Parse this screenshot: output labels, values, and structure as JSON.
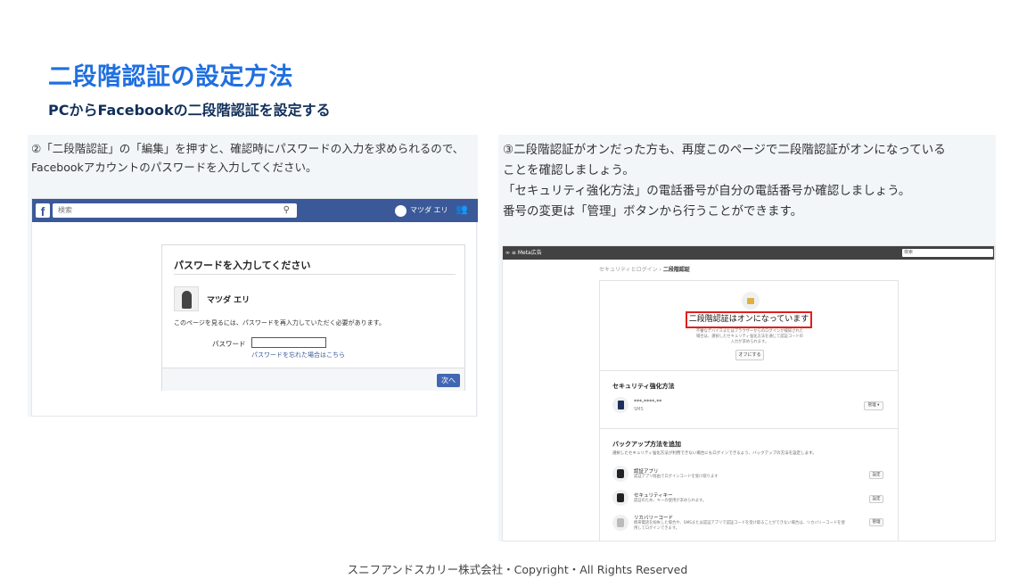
{
  "slide": {
    "title": "二段階認証の設定方法",
    "subtitle": "PCからFacebookの二段階認証を設定する",
    "footer": "スニフアンドスカリー株式会社・Copyright・All Rights Reserved"
  },
  "left_panel": {
    "caption": "②「二段階認証」の「編集」を押すと、確認時にパスワードの入力を求められるので、 Facebookアカウントのパスワードを入力してください。",
    "facebook": {
      "logo": "f",
      "search_placeholder": "検索",
      "user_name": "マツダ エリ",
      "dialog_title": "パスワードを入力してください",
      "dialog_user": "マツダ エリ",
      "dialog_text": "このページを見るには、パスワードを再入力していただく必要があります。",
      "password_label": "パスワード",
      "forgot_link": "パスワードを忘れた場合はこちら",
      "next_button": "次へ"
    }
  },
  "right_panel": {
    "caption_lines": [
      "③二段階認証がオンだった方も、再度このページで二段階認証がオンになっている",
      "ことを確認しましょう。",
      "「セキュリティ強化方法」の電話番号が自分の電話番号か確認しましょう。",
      "番号の変更は「管理」ボタンから行うことができます。"
    ],
    "meta": {
      "brand": "∞ ≡ Meta広告",
      "search_placeholder": "検索",
      "breadcrumb_parent": "セキュリティとログイン ›",
      "breadcrumb_current": "二段階認証",
      "status_title": "二段階認証はオンになっています",
      "status_text": "不審なデバイスまたはブラウザーからのログインが検知された場合は、選択したセキュリティ強化方法を通じて認証コードの入力が求められます。",
      "off_button": "オフにする",
      "security_heading": "セキュリティ強化方法",
      "phone_value": "***-****-**",
      "phone_method": "SMS",
      "manage_button": "管理 ▾",
      "backup_heading": "バックアップ方法を追加",
      "backup_desc": "選択したセキュリティ強化方法が利用できない場合にもログインできるよう、バックアップの方法を設定します。",
      "backup_items": [
        {
          "title": "認証アプリ",
          "sub": "認証アプリ経由でログインコードを受け取ります",
          "button": "設定"
        },
        {
          "title": "セキュリティキー",
          "sub": "認証のため、キーの使用が求められます。",
          "button": "設定"
        },
        {
          "title": "リカバリーコード",
          "sub": "携帯電話を紛失した場合や、SMSまたは認証アプリで認証コードを受け取ることができない場合は、リカバリーコードを使用してログインできます。",
          "button": "管理"
        }
      ]
    }
  }
}
